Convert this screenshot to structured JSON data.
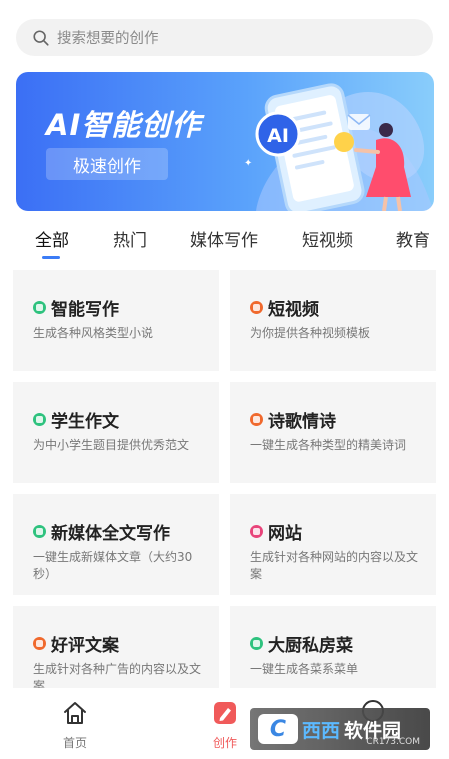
{
  "search": {
    "placeholder": "搜索想要的创作"
  },
  "banner": {
    "title": "AI智能创作",
    "button": "极速创作",
    "art_badge": "AI"
  },
  "tabs": [
    {
      "label": "全部",
      "active": true
    },
    {
      "label": "热门",
      "active": false
    },
    {
      "label": "媒体写作",
      "active": false
    },
    {
      "label": "短视频",
      "active": false
    },
    {
      "label": "教育",
      "active": false
    }
  ],
  "cards": [
    {
      "title": "智能写作",
      "desc": "生成各种风格类型小说",
      "color": "#2ec27e"
    },
    {
      "title": "短视频",
      "desc": "为你提供各种视频模板",
      "color": "#f0692d"
    },
    {
      "title": "学生作文",
      "desc": "为中小学生题目提供优秀范文",
      "color": "#2ec27e"
    },
    {
      "title": "诗歌情诗",
      "desc": "一键生成各种类型的精美诗词",
      "color": "#f0692d"
    },
    {
      "title": "新媒体全文写作",
      "desc": "一键生成新媒体文章（大约30秒）",
      "color": "#2ec27e"
    },
    {
      "title": "网站",
      "desc": "生成针对各种网站的内容以及文案",
      "color": "#e8447a"
    },
    {
      "title": "好评文案",
      "desc": "生成针对各种广告的内容以及文案",
      "color": "#f0692d"
    },
    {
      "title": "大厨私房菜",
      "desc": "一键生成各菜系菜单",
      "color": "#2ec27e"
    }
  ],
  "nav": {
    "home": "首页",
    "create": "创作",
    "active_color": "#f05a5a"
  },
  "watermark": {
    "logo": "C",
    "name_a": "西西",
    "name_b": "软件园",
    "domain": "CR173.COM"
  }
}
